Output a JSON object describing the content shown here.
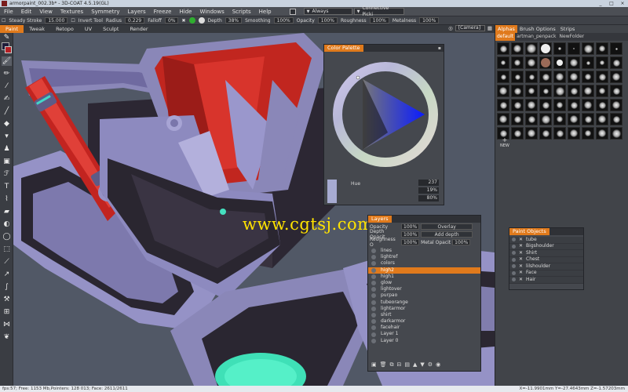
{
  "window": {
    "title": "armorpaint_002.3b* - 3D-COAT 4.5.19(GL)",
    "buttons": [
      "_",
      "□",
      "×"
    ]
  },
  "menu": {
    "items": [
      "File",
      "Edit",
      "View",
      "Textures",
      "Symmetry",
      "Layers",
      "Freeze",
      "Hide",
      "Windows",
      "Scripts",
      "Help"
    ],
    "always_label": "Always",
    "connective_label": "Connective Picki"
  },
  "tool_options": {
    "steady": "Steady Stroke",
    "steady_value": "15.000",
    "invert": "Invert Tool",
    "radius": "Radius",
    "radius_value": "0.229",
    "falloff": "Falloff",
    "falloff_value": "0%",
    "depth": "Depth",
    "depth_value": "38%",
    "smoothing": "Smoothing",
    "smoothing_value": "100%",
    "opacity": "Opacity",
    "opacity_value": "100%",
    "roughness": "Roughness",
    "roughness_value": "100%",
    "metalness": "Metalness",
    "metalness_value": "100%"
  },
  "mode_tabs": [
    "Paint",
    "Tweak",
    "Retopo",
    "UV",
    "Sculpt",
    "Render"
  ],
  "camera": {
    "view": "[Camera]"
  },
  "alphas": {
    "tabs": [
      "Alphas",
      "Brush Options",
      "Strips"
    ],
    "sets": [
      "default",
      "artman_penpack",
      "NewFolder"
    ],
    "new_label": "NEW"
  },
  "color_palette": {
    "title": "Color Palette",
    "hue_label": "Hue",
    "hue_value": "237",
    "sat_value": "19%",
    "val_value": "80%",
    "accent": "#e07a1c"
  },
  "watermark": "www.cgtsj.com",
  "layers": {
    "title": "Layers",
    "opacity_label": "Opacity",
    "opacity_value": "100%",
    "blend_mode": "Overlay",
    "depth_label": "Depth Opacit",
    "depth_value": "100%",
    "depth_mode": "Add depth",
    "rough_label": "Roughness O",
    "rough_value": "100%",
    "metal_label": "Metal Opacit",
    "metal_value": "100%",
    "items": [
      "lines",
      "lightref",
      "colors",
      "high2",
      "high1",
      "glow",
      "lightover",
      "purpao",
      "tubeorange",
      "lightarmor",
      "shirt",
      "darkarmor",
      "facehair",
      "Layer 1",
      "Layer 0"
    ],
    "selected": "high2"
  },
  "paint_objects": {
    "title": "Paint Objects",
    "items": [
      "tube",
      "Bigshoulder",
      "Shirt",
      "Chest",
      "lilshoulder",
      "Face",
      "Hair"
    ]
  },
  "status": {
    "left": "fps:57;   Free: 1153 Mb,Pointers: 128 013; Face: 2611/2611",
    "right": "X=-11.9901mm  Y=-27.4643mm  Z=-1.57203mm"
  }
}
